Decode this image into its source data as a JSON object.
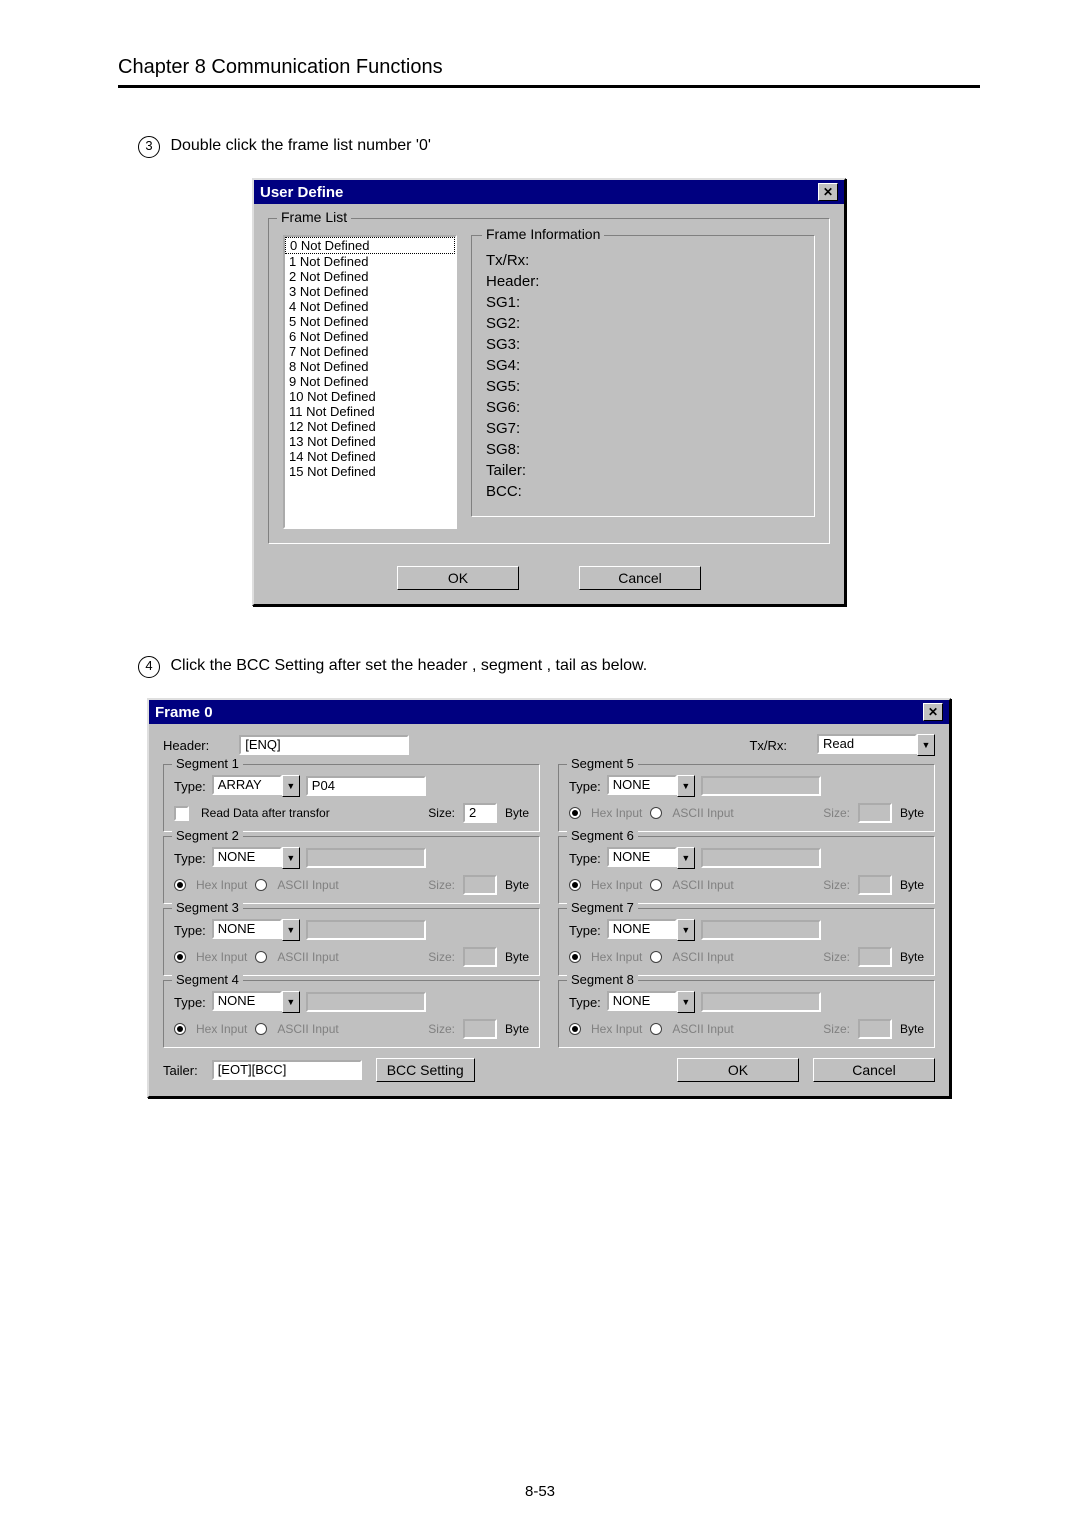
{
  "chapter": "Chapter 8   Communication Functions",
  "steps": {
    "s3": "Double click the frame list number '0'",
    "s4": "Click the BCC Setting after set the header , segment , tail as below."
  },
  "page_number": "8-53",
  "dlg1": {
    "title": "User Define",
    "group": "Frame List",
    "info_title": "Frame Information",
    "list": [
      "0 Not Defined",
      "1 Not Defined",
      "2 Not Defined",
      "3 Not Defined",
      "4 Not Defined",
      "5 Not Defined",
      "6 Not Defined",
      "7 Not Defined",
      "8 Not Defined",
      "9 Not Defined",
      "10 Not Defined",
      "11 Not Defined",
      "12 Not Defined",
      "13 Not Defined",
      "14 Not Defined",
      "15 Not Defined"
    ],
    "info_rows": [
      "Tx/Rx:",
      "Header:",
      "SG1:",
      "SG2:",
      "SG3:",
      "SG4:",
      "SG5:",
      "SG6:",
      "SG7:",
      "SG8:",
      "Tailer:",
      "BCC:"
    ],
    "ok": "OK",
    "cancel": "Cancel"
  },
  "dlg2": {
    "title": "Frame 0",
    "header_label": "Header:",
    "header_value": "[ENQ]",
    "txrx_label": "Tx/Rx:",
    "txrx_value": "Read",
    "type_label": "Type:",
    "size_label": "Size:",
    "byte_label": "Byte",
    "hex_label": "Hex Input",
    "ascii_label": "ASCII Input",
    "read_after": "Read Data after transfor",
    "tailer_label": "Tailer:",
    "tailer_value": "[EOT][BCC]",
    "bcc_btn": "BCC Setting",
    "ok": "OK",
    "cancel": "Cancel",
    "segments": [
      {
        "legend": "Segment 1",
        "type": "ARRAY",
        "val": "P04",
        "size": "2",
        "mode": "read",
        "disabled": false
      },
      {
        "legend": "Segment 5",
        "type": "NONE",
        "val": "",
        "size": "",
        "mode": "hex",
        "disabled": true
      },
      {
        "legend": "Segment 2",
        "type": "NONE",
        "val": "",
        "size": "",
        "mode": "hex",
        "disabled": true
      },
      {
        "legend": "Segment 6",
        "type": "NONE",
        "val": "",
        "size": "",
        "mode": "hex",
        "disabled": true
      },
      {
        "legend": "Segment 3",
        "type": "NONE",
        "val": "",
        "size": "",
        "mode": "hex",
        "disabled": true
      },
      {
        "legend": "Segment 7",
        "type": "NONE",
        "val": "",
        "size": "",
        "mode": "hex",
        "disabled": true
      },
      {
        "legend": "Segment 4",
        "type": "NONE",
        "val": "",
        "size": "",
        "mode": "hex",
        "disabled": true
      },
      {
        "legend": "Segment 8",
        "type": "NONE",
        "val": "",
        "size": "",
        "mode": "hex",
        "disabled": true
      }
    ]
  }
}
